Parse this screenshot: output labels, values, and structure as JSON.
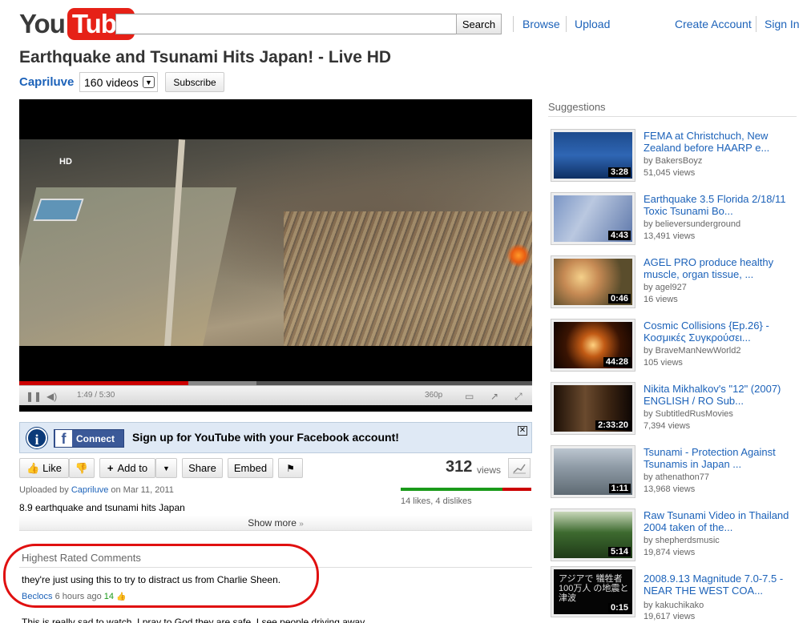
{
  "header": {
    "logo_you": "You",
    "logo_tube": "Tube",
    "search_placeholder": "",
    "search_label": "Search",
    "nav": [
      "Browse",
      "Upload",
      "Create Account",
      "Sign In"
    ]
  },
  "video": {
    "title": "Earthquake and Tsunami Hits Japan! - Live HD",
    "channel": "Capriluve",
    "videos_count": "160 videos",
    "subscribe": "Subscribe",
    "player": {
      "hd_badge": "HD",
      "time": "1:49 / 5:30",
      "quality": "360p",
      "played_fraction": 0.33
    }
  },
  "fb_banner": {
    "info_icon": "i",
    "connect_label": "Connect",
    "message": "Sign up for YouTube with your Facebook account!",
    "close": "✕"
  },
  "actions": {
    "like": "Like",
    "add_to": "Add to",
    "share": "Share",
    "embed": "Embed",
    "views_count": "312",
    "views_label": "views"
  },
  "details": {
    "uploaded_prefix": "Uploaded by",
    "uploader": "Capriluve",
    "uploaded_date": "on Mar 11, 2011",
    "description": "8.9 earthquake and tsunami hits Japan",
    "likes_summary": "14 likes, 4 dislikes",
    "likes": 14,
    "dislikes": 4,
    "show_more": "Show more"
  },
  "comments": {
    "heading": "Highest Rated Comments",
    "items": [
      {
        "text": "they're just using this to try to distract us from Charlie Sheen.",
        "author": "Beclocs",
        "time": "6 hours ago",
        "score": "14"
      },
      {
        "text": "This is really sad to watch. I pray to God they are safe. I see people driving away"
      }
    ]
  },
  "suggestions": {
    "heading": "Suggestions",
    "items": [
      {
        "title": "FEMA at Christchuch, New Zealand before HAARP e...",
        "user": "by BakersBoyz",
        "views": "51,045 views",
        "duration": "3:28"
      },
      {
        "title": "Earthquake 3.5 Florida 2/18/11 Toxic Tsunami Bo...",
        "user": "by believersunderground",
        "views": "13,491 views",
        "duration": "4:43"
      },
      {
        "title": "AGEL PRO produce healthy muscle, organ tissue, ...",
        "user": "by agel927",
        "views": "16 views",
        "duration": "0:46"
      },
      {
        "title": "Cosmic Collisions {Ep.26} - Κοσμικές Συγκρούσει...",
        "user": "by BraveManNewWorld2",
        "views": "105 views",
        "duration": "44:28"
      },
      {
        "title": "Nikita Mikhalkov's \"12\" (2007) ENGLISH / RO Sub...",
        "user": "by SubtitledRusMovies",
        "views": "7,394 views",
        "duration": "2:33:20"
      },
      {
        "title": "Tsunami - Protection Against Tsunamis in Japan ...",
        "user": "by athenathon77",
        "views": "13,968 views",
        "duration": "1:11"
      },
      {
        "title": "Raw Tsunami Video in Thailand 2004 taken of the...",
        "user": "by shepherdsmusic",
        "views": "19,874 views",
        "duration": "5:14"
      },
      {
        "title": "2008.9.13 Magnitude 7.0-7.5 - NEAR THE WEST COA...",
        "user": "by kakuchikako",
        "views": "19,617 views",
        "duration": "0:15",
        "thumb_text": "アジアで 犠牲者100万人 の地震と津波"
      }
    ]
  }
}
